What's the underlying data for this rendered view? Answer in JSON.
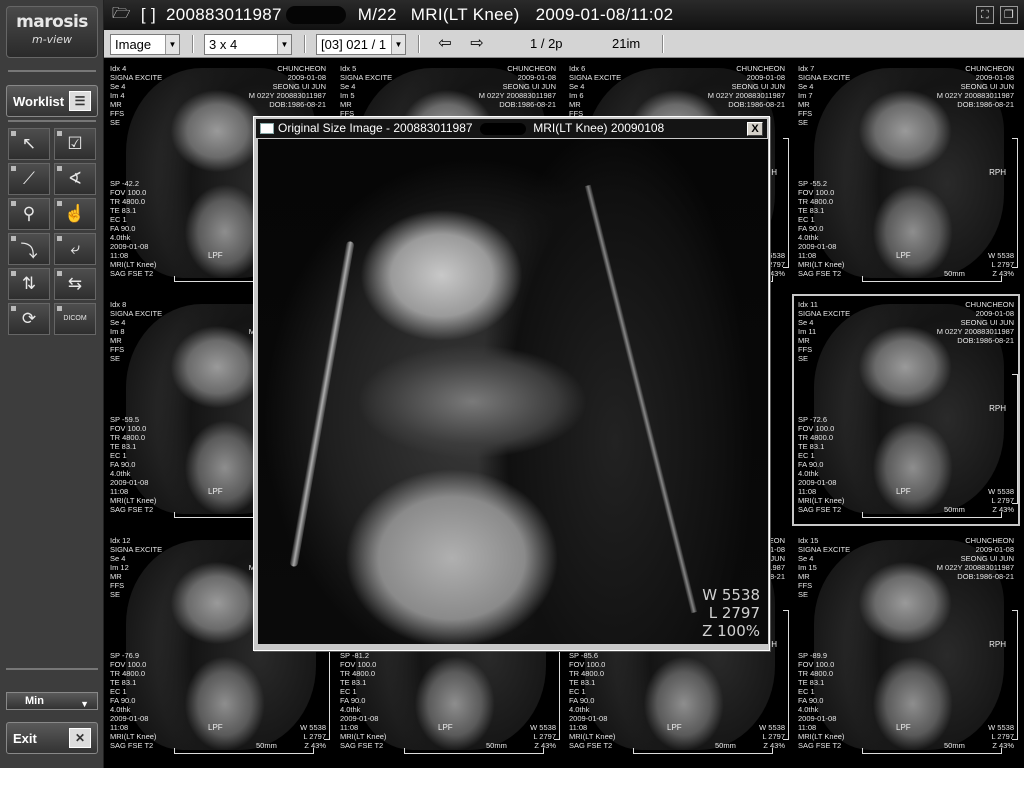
{
  "app": {
    "logo_line1": "marosis",
    "logo_line2": "m-view"
  },
  "sidebar": {
    "worklist_label": "Worklist",
    "tools": [
      {
        "name": "pointer-tool",
        "glyph": "↖"
      },
      {
        "name": "check-tool",
        "glyph": "☑"
      },
      {
        "name": "ruler-tool",
        "glyph": "⟋"
      },
      {
        "name": "angle-tool",
        "glyph": "∢"
      },
      {
        "name": "zoom-tool",
        "glyph": "⚲"
      },
      {
        "name": "pan-tool",
        "glyph": "☝"
      },
      {
        "name": "rotate-right-tool",
        "glyph": "⤵"
      },
      {
        "name": "rotate-left-tool",
        "glyph": "⤶"
      },
      {
        "name": "flip-vertical-tool",
        "glyph": "⇅"
      },
      {
        "name": "flip-horizontal-tool",
        "glyph": "⇆"
      },
      {
        "name": "reset-tool",
        "glyph": "⟳"
      },
      {
        "name": "dicom-tool",
        "glyph": "DICOM"
      }
    ],
    "min_label": "Min",
    "exit_label": "Exit"
  },
  "header": {
    "bracket": "[ ]",
    "patient_id": "200883011987",
    "sex_age": "M/22",
    "study": "MRI(LT Knee)",
    "datetime": "2009-01-08/11:02"
  },
  "toolbar": {
    "mode": "Image",
    "layout": "3 x 4",
    "series": "[03] 021 / 1",
    "page": "1 / 2p",
    "count": "21im"
  },
  "cells": [
    {
      "idx": "Idx 4",
      "im": "Im 4",
      "sp": "SP -42.2",
      "orient": "LPF",
      "sel": false,
      "col": 0,
      "row": 0
    },
    {
      "idx": "Idx 5",
      "im": "Im 5",
      "sp": "",
      "orient": "",
      "sel": false,
      "col": 1,
      "row": 0
    },
    {
      "idx": "Idx 6",
      "im": "Im 6",
      "sp": "",
      "orient": "",
      "sel": false,
      "col": 2,
      "row": 0
    },
    {
      "idx": "Idx 7",
      "im": "Im 7",
      "sp": "SP -55.2",
      "orient": "LPF",
      "sel": false,
      "col": 3,
      "row": 0
    },
    {
      "idx": "Idx 8",
      "im": "Im 8",
      "sp": "SP -59.5",
      "orient": "LPF",
      "sel": false,
      "col": 0,
      "row": 1
    },
    {
      "idx": "Idx 11",
      "im": "Im 11",
      "sp": "SP -72.6",
      "orient": "LPF",
      "sel": true,
      "col": 3,
      "row": 1
    },
    {
      "idx": "Idx 12",
      "im": "Im 12",
      "sp": "SP -76.9",
      "orient": "LPF",
      "sel": false,
      "col": 0,
      "row": 2
    },
    {
      "idx": "",
      "im": "",
      "sp": "SP -81.2",
      "orient": "LPF",
      "sel": false,
      "col": 1,
      "row": 2
    },
    {
      "idx": "",
      "im": "",
      "sp": "SP -85.6",
      "orient": "LPF",
      "sel": false,
      "col": 2,
      "row": 2
    },
    {
      "idx": "Idx 15",
      "im": "Im 15",
      "sp": "SP -89.9",
      "orient": "LPF",
      "sel": false,
      "col": 3,
      "row": 2
    }
  ],
  "cell_common": {
    "scanner": "SIGNA EXCITE",
    "se": "Se 4",
    "mr": "MR",
    "ffs": "FFS",
    "se2": "SE",
    "hospital": "CHUNCHEON",
    "date": "2009-01-08",
    "physician": "SEONG UI JUN",
    "mline": "M 022Y 200883011987",
    "dob": "DOB:1986-08-21",
    "fov": "FOV 100.0",
    "tr": "TR 4800.0",
    "te": "TE 83.1",
    "ec": "EC 1",
    "fa": "FA 90.0",
    "thk": "4.0thk",
    "time": "11:08",
    "protocol": "MRI(LT Knee)",
    "sequence": "SAG FSE T2",
    "w": "W 5538",
    "l": "L 2797",
    "z": "Z 43%",
    "mm": "50mm",
    "rph": "RPH"
  },
  "popup": {
    "title_prefix": "Original Size Image - 200883011987",
    "title_suffix": "MRI(LT Knee)  20090108",
    "close_label": "X",
    "w": "W 5538",
    "l": "L 2797",
    "z": "Z 100%"
  }
}
